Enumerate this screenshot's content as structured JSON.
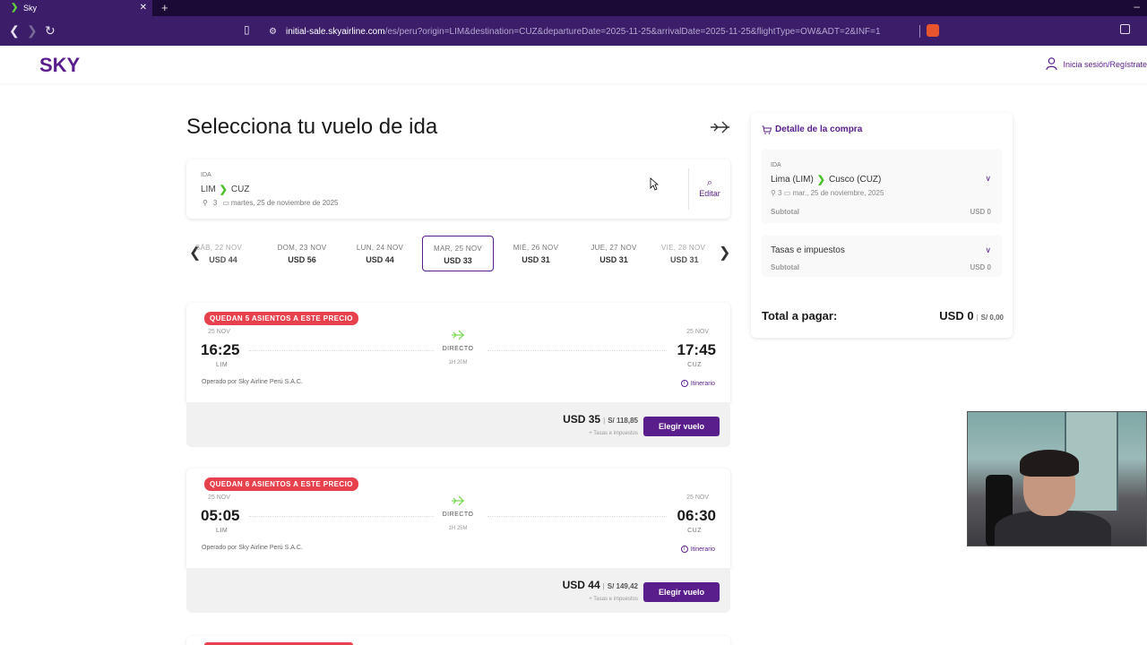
{
  "browser": {
    "tab_title": "Sky",
    "url_host": "initial-sale.skyairline.com",
    "url_path": "/es/peru?origin=LIM&destination=CUZ&departureDate=2025-11-25&arrivalDate=2025-11-25&flightType=OW&ADT=2&INF=1"
  },
  "header": {
    "logo": "SKY",
    "login_label": "Inicia sesión/Regístrate"
  },
  "main": {
    "title": "Selecciona tu vuelo de ida"
  },
  "search": {
    "tag": "IDA",
    "origin": "LIM",
    "destination": "CUZ",
    "passengers": "3",
    "date": "martes, 25 de noviembre de 2025",
    "edit_label": "Editar"
  },
  "dates": [
    {
      "label": "SÁB, 22 NOV",
      "price": "USD 44"
    },
    {
      "label": "DOM, 23 NOV",
      "price": "USD 56"
    },
    {
      "label": "LUN, 24 NOV",
      "price": "USD 44"
    },
    {
      "label": "MAR, 25 NOV",
      "price": "USD 33"
    },
    {
      "label": "MIÉ, 26 NOV",
      "price": "USD 31"
    },
    {
      "label": "JUE, 27 NOV",
      "price": "USD 31"
    },
    {
      "label": "VIE, 28 NOV",
      "price": "USD 31"
    }
  ],
  "flights": [
    {
      "badge": "QUEDAN 5 ASIENTOS A ESTE PRECIO",
      "dep_date": "25 NOV",
      "dep_time": "16:25",
      "dep_code": "LIM",
      "arr_date": "25 NOV",
      "arr_time": "17:45",
      "arr_code": "CUZ",
      "type": "DIRECTO",
      "duration": "1H 20M",
      "operator": "Operado por Sky Airline Perú S.A.C.",
      "itinerary": "Itinerario",
      "price_usd": "USD 35",
      "price_pen": "S/ 118,85",
      "tax_note": "+ Tasas e impuestos",
      "button": "Elegir vuelo"
    },
    {
      "badge": "QUEDAN 6 ASIENTOS A ESTE PRECIO",
      "dep_date": "25 NOV",
      "dep_time": "05:05",
      "dep_code": "LIM",
      "arr_date": "25 NOV",
      "arr_time": "06:30",
      "arr_code": "CUZ",
      "type": "DIRECTO",
      "duration": "1H 25M",
      "operator": "Operado por Sky Airline Perú S.A.C.",
      "itinerary": "Itinerario",
      "price_usd": "USD 44",
      "price_pen": "S/ 149,42",
      "tax_note": "+ Tasas e impuestos",
      "button": "Elegir vuelo"
    }
  ],
  "summary": {
    "title": "Detalle de la compra",
    "tag": "IDA",
    "origin": "Lima (LIM)",
    "destination": "Cusco (CUZ)",
    "meta_pax": "3",
    "meta_date": "mar., 25 de noviembre, 2025",
    "subtotal_label": "Subtotal",
    "subtotal_value": "USD 0",
    "taxes_label": "Tasas e impuestos",
    "taxes_subtotal_label": "Subtotal",
    "taxes_subtotal_value": "USD 0",
    "total_label": "Total a pagar:",
    "total_usd": "USD 0",
    "total_pen": "S/ 0,00"
  },
  "colors": {
    "brand": "#5a1e8c",
    "accent_green": "#4cc02a",
    "badge_red": "#e8414e"
  }
}
